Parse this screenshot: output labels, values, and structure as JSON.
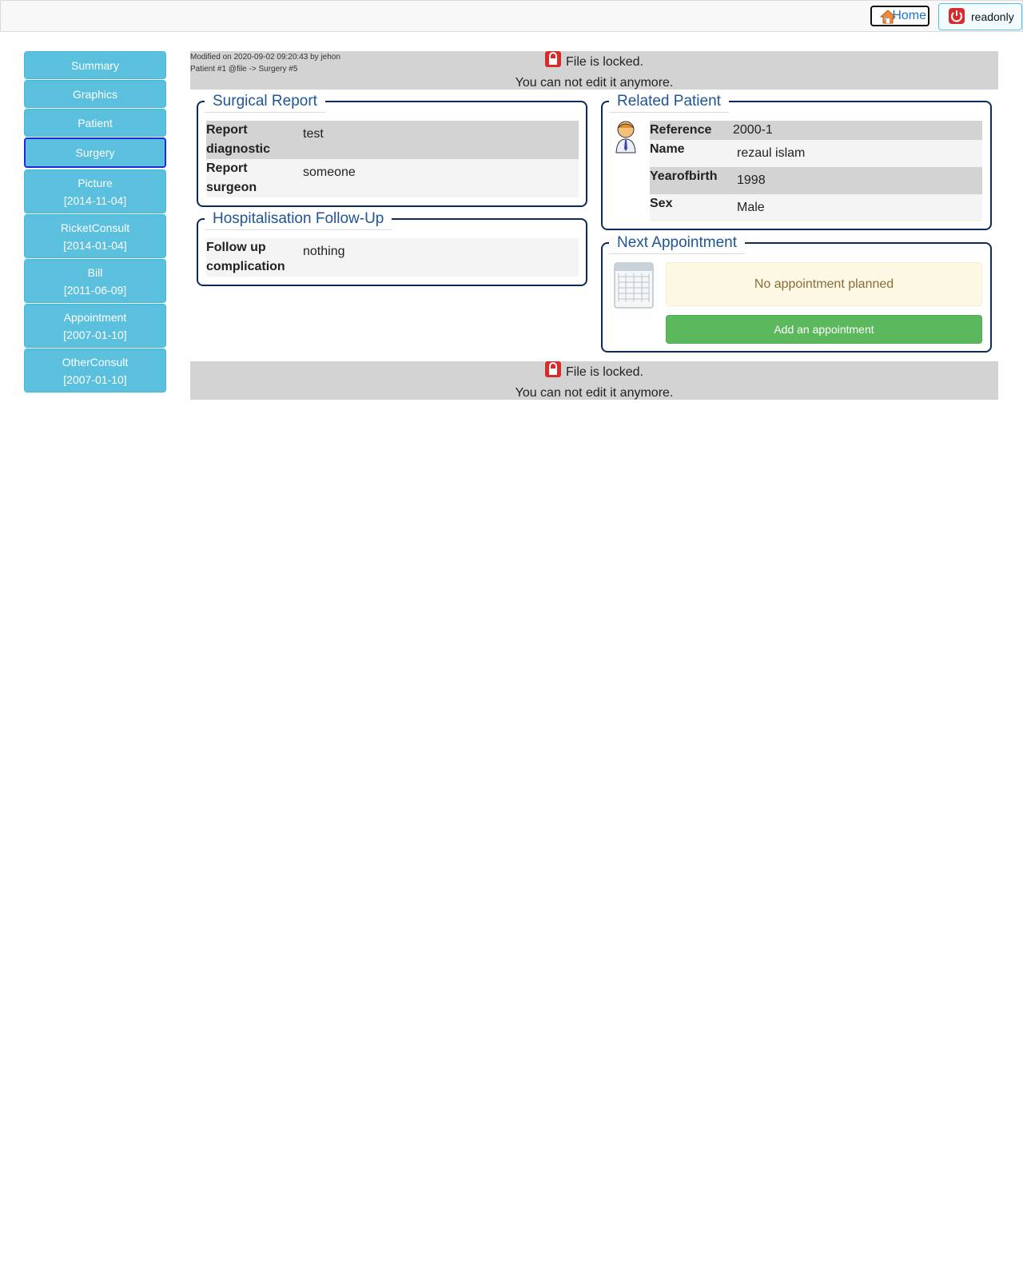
{
  "header": {
    "home_label": "Home",
    "readonly_label": "readonly"
  },
  "sidebar": {
    "items": [
      {
        "label": "Summary",
        "date": ""
      },
      {
        "label": "Graphics",
        "date": ""
      },
      {
        "label": "Patient",
        "date": ""
      },
      {
        "label": "Surgery",
        "date": ""
      },
      {
        "label": "Picture",
        "date": "[2014-11-04]"
      },
      {
        "label": "RicketConsult",
        "date": "[2014-01-04]"
      },
      {
        "label": "Bill",
        "date": "[2011-06-09]"
      },
      {
        "label": "Appointment",
        "date": "[2007-01-10]"
      },
      {
        "label": "OtherConsult",
        "date": "[2007-01-10]"
      }
    ]
  },
  "meta": {
    "modified": "Modified on 2020-09-02 09:20:43 by jehon",
    "path": "Patient #1 @file -> Surgery #5"
  },
  "lock": {
    "line1": "File is locked.",
    "line2": "You can not edit it anymore."
  },
  "surgical_report": {
    "title": "Surgical Report",
    "rows": [
      {
        "key_line1": "Report",
        "key_line2": "diagnostic",
        "value": "test"
      },
      {
        "key_line1": "Report",
        "key_line2": "surgeon",
        "value": "someone"
      }
    ]
  },
  "followup": {
    "title": "Hospitalisation Follow-Up",
    "rows": [
      {
        "key_line1": "Follow up",
        "key_line2": "complication",
        "value": "nothing"
      }
    ]
  },
  "related_patient": {
    "title": "Related Patient",
    "rows": [
      {
        "key": "Reference",
        "value": "2000-1"
      },
      {
        "key": "Name",
        "value": "rezaul islam"
      },
      {
        "key": "Yearofbirth",
        "value": "1998"
      },
      {
        "key": "Sex",
        "value": "Male"
      }
    ]
  },
  "next_appointment": {
    "title": "Next Appointment",
    "note": "No appointment planned",
    "button": "Add an appointment"
  },
  "colors": {
    "sidebar": "#5bc0de",
    "lockbar": "#d3d3d3",
    "box_border": "#0d2a5c",
    "legend": "#1f5597",
    "add_button": "#5cb85c"
  }
}
